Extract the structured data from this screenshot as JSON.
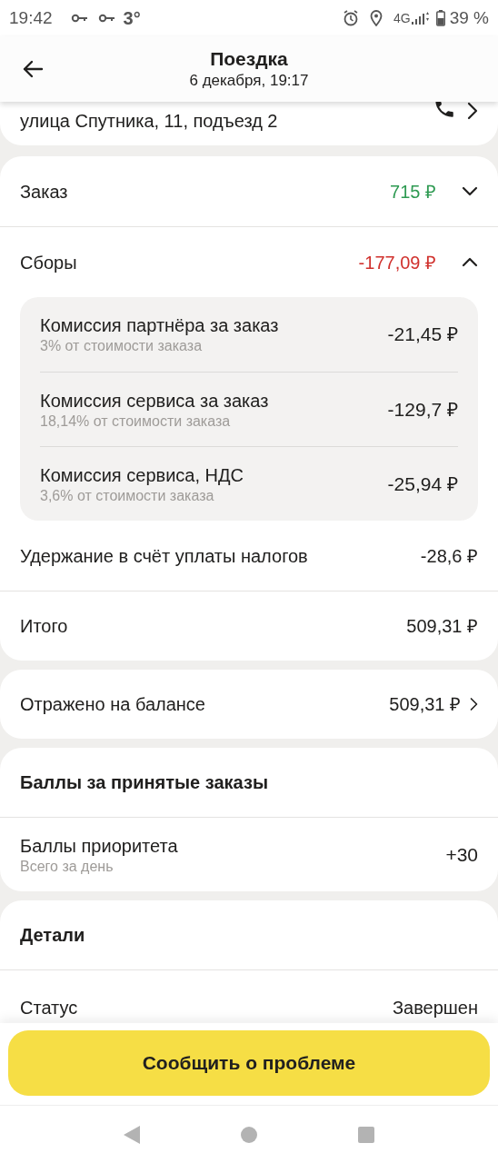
{
  "status_bar": {
    "time": "19:42",
    "temperature": "3°",
    "network": "4G",
    "battery": "39 %"
  },
  "header": {
    "title": "Поездка",
    "subtitle": "6 декабря, 19:17"
  },
  "address": {
    "text": "улица Спутника, 11, подъезд 2"
  },
  "summary": {
    "rows": [
      {
        "label": "Заказ",
        "amount": "715 ₽",
        "color": "#2e9a52",
        "expanded": false
      },
      {
        "label": "Сборы",
        "amount": "-177,09 ₽",
        "color": "#d0312d",
        "expanded": true
      }
    ],
    "fees": [
      {
        "title": "Комиссия партнёра за заказ",
        "subtitle": "3% от стоимости заказа",
        "amount": "-21,45 ₽"
      },
      {
        "title": "Комиссия сервиса за заказ",
        "subtitle": "18,14% от стоимости заказа",
        "amount": "-129,7 ₽"
      },
      {
        "title": "Комиссия сервиса, НДС",
        "subtitle": "3,6% от стоимости заказа",
        "amount": "-25,94 ₽"
      }
    ],
    "tax": {
      "label": "Удержание в счёт уплаты налогов",
      "amount": "-28,6 ₽"
    },
    "total": {
      "label": "Итого",
      "amount": "509,31 ₽"
    }
  },
  "balance": {
    "label": "Отражено на балансе",
    "amount": "509,31 ₽"
  },
  "points": {
    "title": "Баллы за принятые заказы",
    "label": "Баллы приоритета",
    "subtitle": "Всего за день",
    "value": "+30"
  },
  "details": {
    "title": "Детали",
    "rows": [
      {
        "label": "Статус",
        "value": "Завершен"
      }
    ]
  },
  "report_button": "Сообщить о проблеме"
}
